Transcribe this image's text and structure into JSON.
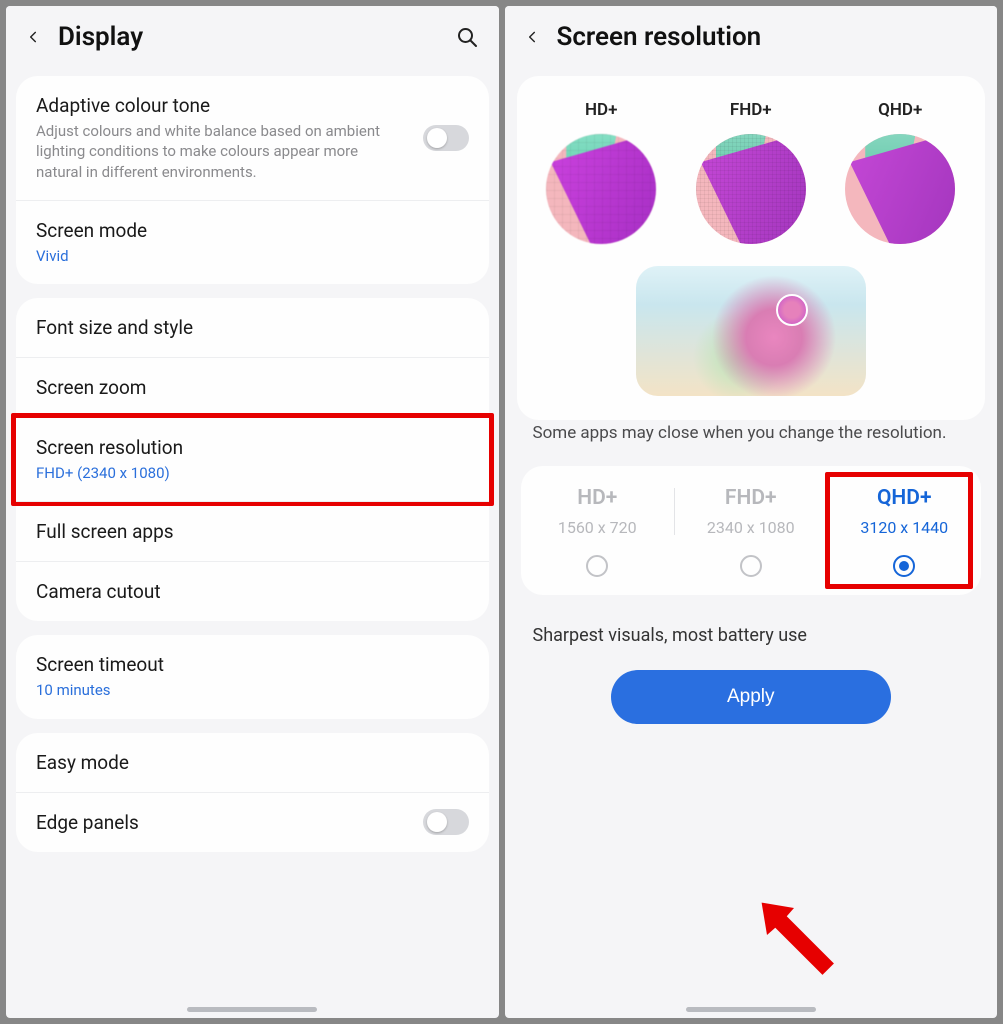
{
  "left": {
    "title": "Display",
    "adaptive": {
      "title": "Adaptive colour tone",
      "desc": "Adjust colours and white balance based on ambient lighting conditions to make colours appear more natural in different environments."
    },
    "screenMode": {
      "title": "Screen mode",
      "value": "Vivid"
    },
    "fontSize": "Font size and style",
    "screenZoom": "Screen zoom",
    "screenResolution": {
      "title": "Screen resolution",
      "value": "FHD+ (2340 x 1080)"
    },
    "fullScreenApps": "Full screen apps",
    "cameraCutout": "Camera cutout",
    "screenTimeout": {
      "title": "Screen timeout",
      "value": "10 minutes"
    },
    "easyMode": "Easy mode",
    "edgePanels": "Edge panels"
  },
  "right": {
    "title": "Screen resolution",
    "previews": [
      "HD+",
      "FHD+",
      "QHD+"
    ],
    "note": "Some apps may close when you change the resolution.",
    "options": [
      {
        "title": "HD+",
        "sub": "1560 x 720",
        "selected": false
      },
      {
        "title": "FHD+",
        "sub": "2340 x 1080",
        "selected": false
      },
      {
        "title": "QHD+",
        "sub": "3120 x 1440",
        "selected": true
      }
    ],
    "descText": "Sharpest visuals, most battery use",
    "applyLabel": "Apply"
  }
}
